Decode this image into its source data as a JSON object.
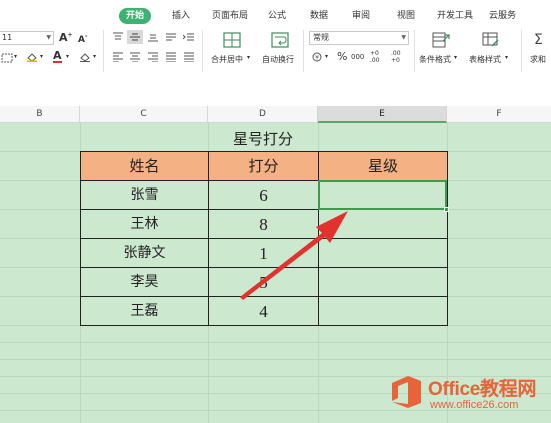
{
  "ribbon": {
    "tabs": [
      {
        "label": "开始",
        "active": true
      },
      {
        "label": "插入"
      },
      {
        "label": "页面布局"
      },
      {
        "label": "公式"
      },
      {
        "label": "数据"
      },
      {
        "label": "审阅"
      },
      {
        "label": "视图"
      },
      {
        "label": "开发工具"
      },
      {
        "label": "云服务"
      }
    ],
    "font_size": "11",
    "font_grow": "A",
    "font_shrink": "A",
    "font_color_letter": "A",
    "merge_label": "合并居中",
    "wrap_label": "自动换行",
    "number_format": "常规",
    "percent": "%",
    "thousands": "000",
    "inc_decimal": "+0 .00",
    "dec_decimal": ".00 +0",
    "cond_format_label": "条件格式",
    "table_style_label": "表格样式",
    "sum_label": "求和",
    "accent": "#3cb371"
  },
  "columns": [
    {
      "label": "B"
    },
    {
      "label": "C"
    },
    {
      "label": "D"
    },
    {
      "label": "E",
      "selected": true
    },
    {
      "label": "F"
    }
  ],
  "sheet": {
    "title": "星号打分",
    "headers": [
      "姓名",
      "打分",
      "星级"
    ],
    "rows": [
      {
        "name": "张雪",
        "score": "6",
        "stars": ""
      },
      {
        "name": "王林",
        "score": "8",
        "stars": ""
      },
      {
        "name": "张静文",
        "score": "1",
        "stars": ""
      },
      {
        "name": "李昊",
        "score": "5",
        "stars": ""
      },
      {
        "name": "王磊",
        "score": "4",
        "stars": ""
      }
    ],
    "header_fill": "#f4b183",
    "grid_fill": "#cce8cf"
  },
  "watermark": {
    "brand": "Office教程网",
    "url": "www.office26.com"
  }
}
